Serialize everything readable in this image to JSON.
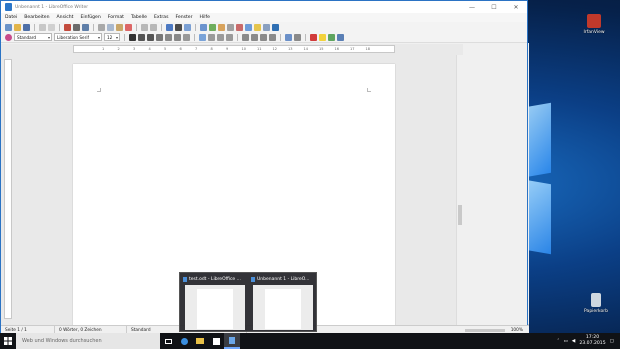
{
  "desktop": {
    "icons": [
      {
        "label": "IrfanView"
      },
      {
        "label": "Papierkorb"
      }
    ]
  },
  "writer": {
    "window_title": "Unbenannt 1 - LibreOffice Writer",
    "menu": [
      "Datei",
      "Bearbeiten",
      "Ansicht",
      "Einfügen",
      "Format",
      "Tabelle",
      "Extras",
      "Fenster",
      "Hilfe"
    ],
    "menu_close": "×",
    "paragraph_style": "Standard",
    "font_name": "Liberation Serif",
    "font_size": "12",
    "ruler_ticks": [
      "1",
      "2",
      "3",
      "4",
      "5",
      "6",
      "7",
      "8",
      "9",
      "10",
      "11",
      "12",
      "13",
      "14",
      "15",
      "16",
      "17",
      "18"
    ],
    "status": {
      "page": "Seite 1 / 1",
      "words": "0 Wörter, 0 Zeichen",
      "style": "Standard",
      "zoom": "100%"
    },
    "second_status_zoom": "100%"
  },
  "preview": {
    "items": [
      {
        "label": "test.odt - LibreOffice ..."
      },
      {
        "label": "Unbenannt 1 - LibreO..."
      }
    ]
  },
  "taskbar": {
    "search_placeholder": "Web und Windows durchsuchen",
    "time": "17:20",
    "date": "23.07.2015"
  },
  "colors": {
    "accent": "#2b73c4",
    "taskbar": "#101216",
    "desktop": "#0b3f86"
  }
}
